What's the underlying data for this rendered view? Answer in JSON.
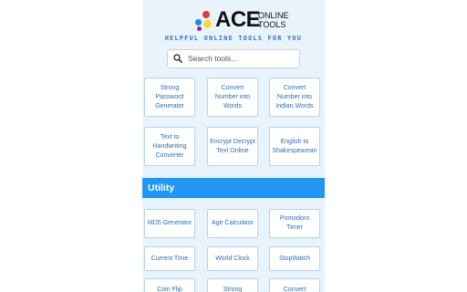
{
  "logo": {
    "name": "ACE",
    "sub_line1": "ONLINE",
    "sub_line2": "TOOLS",
    "dot_colors": [
      "#e53935",
      "#1e88e5",
      "#fdd835",
      "#8e24aa"
    ]
  },
  "tagline": "HELPFUL ONLINE TOOLS FOR YOU",
  "search": {
    "placeholder": "Search tools...",
    "icon": "search-icon"
  },
  "converters": [
    "Strong Password Generator",
    "Convert Number into Words",
    "Convert Number into Indian Words",
    "Text to Handwriting Converter",
    "Encrypt Decrypt Text Online",
    "English to Shakespearean"
  ],
  "utility": {
    "title": "Utility",
    "tools": [
      "MD5 Generator",
      "Age Calculator",
      "Pomodoro Timer",
      "Current Time",
      "World Clock",
      "StopWatch",
      "Coin Flip",
      "Strong",
      "Convert"
    ]
  },
  "colors": {
    "accent": "#2196f3",
    "panel_bg": "#e9f3fb",
    "link": "#2f6fb0"
  }
}
